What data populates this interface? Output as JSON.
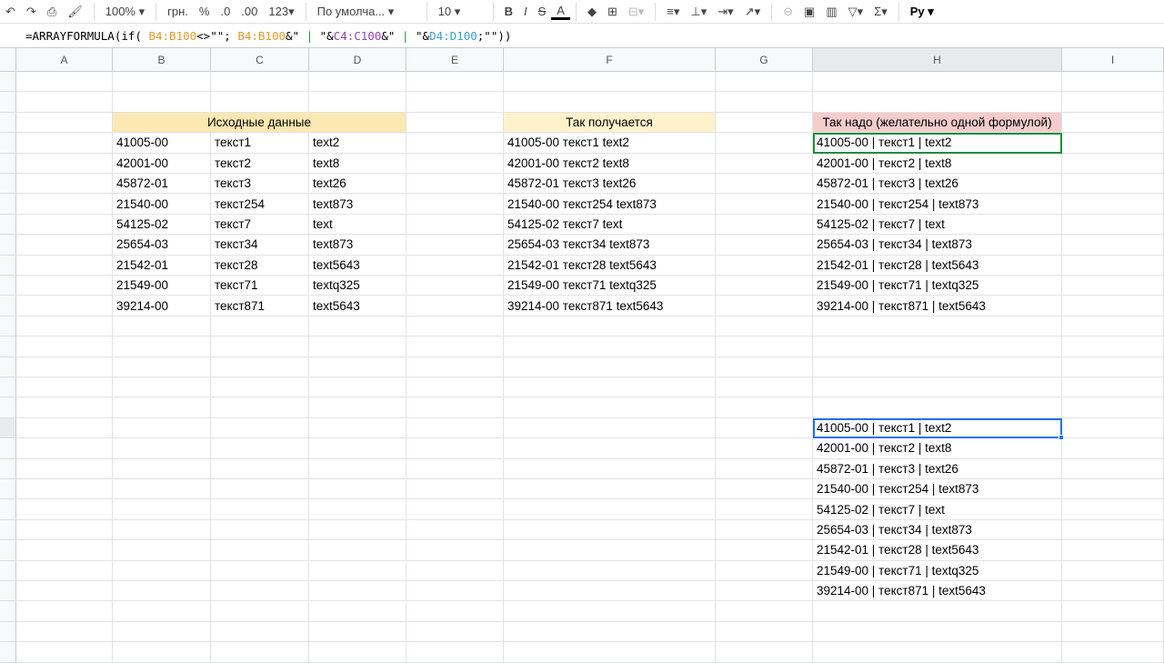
{
  "toolbar": {
    "undo": "↶",
    "redo": "↷",
    "zoom": "100%",
    "currency": "грн.",
    "percent": "%",
    "dec_less": ".0",
    "dec_more": ".00",
    "format": "123",
    "font": "По умолча...",
    "size": "10",
    "bold": "B",
    "italic": "I",
    "strike": "S",
    "text_color": "A",
    "function": "Σ",
    "input_tools": "Py"
  },
  "formula": {
    "prefix": "=ARRAYFORMULA(if( ",
    "r1": "B4:B100",
    "mid1": "<>\"\"; ",
    "r2": "B4:B100",
    "mid2": "&\"",
    "pipe1": " | ",
    "q1": "\"&",
    "r3": "C4:C100",
    "mid3": "&\"",
    "pipe2": " | ",
    "q2": "\"&",
    "r4": "D4:D100",
    "end": ";\"\"))"
  },
  "columns": [
    "A",
    "B",
    "C",
    "D",
    "E",
    "F",
    "G",
    "H",
    "I"
  ],
  "headers": {
    "source": "Исходные данные",
    "result": "Так получается",
    "wanted": "Так надо (желательно одной формулой)"
  },
  "colors": {
    "source": "#fce8b2",
    "result": "#fdf2cc",
    "wanted": "#f4cccc"
  },
  "rows": [
    [
      "41005-00",
      "текст1",
      "text2",
      "41005-00 текст1 text2",
      "41005-00 | текст1 | text2"
    ],
    [
      "42001-00",
      "текст2",
      "text8",
      "42001-00 текст2 text8",
      "42001-00 | текст2 | text8"
    ],
    [
      "45872-01",
      "текст3",
      "text26",
      "45872-01 текст3 text26",
      "45872-01 | текст3 | text26"
    ],
    [
      "21540-00",
      "текст254",
      "text873",
      "21540-00 текст254 text873",
      "21540-00 | текст254 | text873"
    ],
    [
      "54125-02",
      "текст7",
      "text",
      "54125-02 текст7 text",
      "54125-02 | текст7 | text"
    ],
    [
      "25654-03",
      "текст34",
      "text873",
      "25654-03 текст34 text873",
      "25654-03 | текст34 | text873"
    ],
    [
      "21542-01",
      "текст28",
      "text5643",
      "21542-01 текст28 text5643",
      "21542-01 | текст28 | text5643"
    ],
    [
      "21549-00",
      "текст71",
      "textq325",
      "21549-00 текст71 textq325",
      "21549-00 | текст71 | textq325"
    ],
    [
      "39214-00",
      "текст871",
      "text5643",
      "39214-00 текст871 text5643",
      "39214-00 | текст871 | text5643"
    ]
  ],
  "formula_output": [
    "41005-00 | текст1 | text2",
    "42001-00 | текст2 | text8",
    "45872-01 | текст3 | text26",
    "21540-00 | текст254 | text873",
    "54125-02 | текст7 | text",
    "25654-03 | текст34 | text873",
    "21542-01 | текст28 | text5643",
    "21549-00 | текст71 | textq325",
    "39214-00 | текст871 | text5643"
  ]
}
